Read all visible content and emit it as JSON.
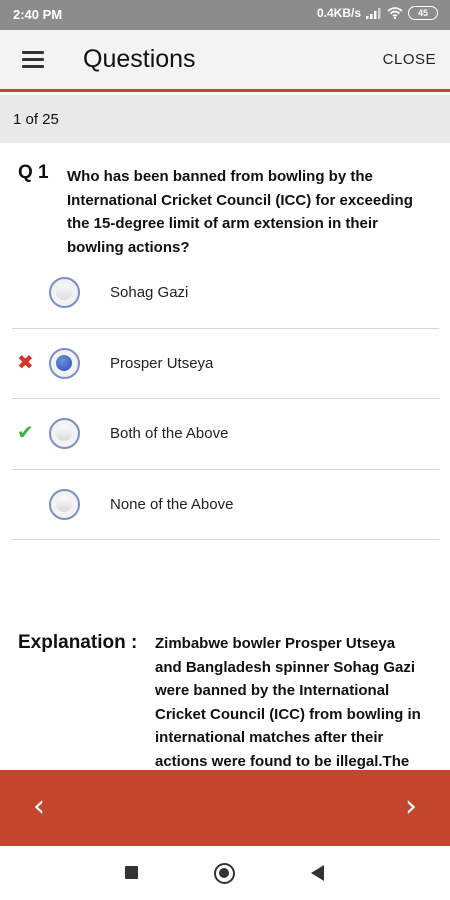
{
  "status_bar": {
    "time": "2:40 PM",
    "network_speed": "0.4KB/s",
    "battery": "45",
    "icons": [
      "signal-icon",
      "wifi-icon",
      "battery-icon"
    ]
  },
  "app_bar": {
    "title": "Questions",
    "close_label": "CLOSE",
    "menu_icon": "hamburger-menu-icon"
  },
  "counter": "1 of 25",
  "question": {
    "number": "Q 1",
    "text": "Who has been banned from bowling by the International Cricket Council (ICC) for exceeding the 15-degree limit of arm extension in their bowling actions?"
  },
  "options": [
    {
      "label": "Sohag Gazi",
      "selected": false,
      "mark": ""
    },
    {
      "label": "Prosper Utseya",
      "selected": true,
      "mark": "wrong"
    },
    {
      "label": "Both of the Above",
      "selected": false,
      "mark": "correct"
    },
    {
      "label": "None of the Above",
      "selected": false,
      "mark": ""
    }
  ],
  "marks": {
    "wrong": "✖",
    "correct": "✔"
  },
  "explanation": {
    "label": "Explanation :",
    "text": "Zimbabwe bowler Prosper Utseya and Bangladesh spinner Sohag Gazi were banned by the International Cricket Council (ICC) from bowling in international matches after their actions were found to be illegal.The"
  },
  "navigation": {
    "prev_glyph": "‹",
    "next_glyph": "›"
  },
  "colors": {
    "accent": "#c2452d",
    "correct": "#3cb53c",
    "wrong": "#d9322a",
    "radio_selected": "#2b4fb3"
  }
}
